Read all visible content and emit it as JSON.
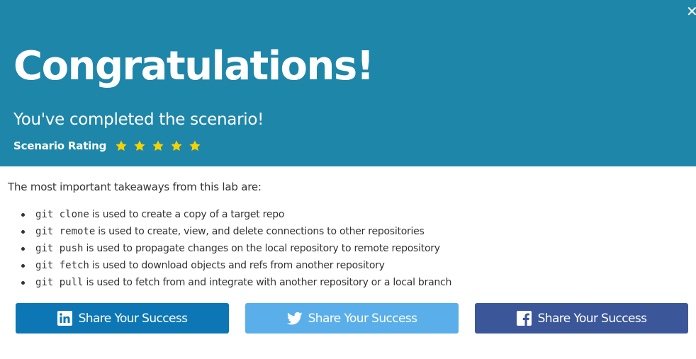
{
  "header": {
    "close_symbol": "✕",
    "title": "Congratulations!",
    "subtitle": "You've completed the scenario!",
    "rating_label": "Scenario Rating",
    "rating_stars": 5,
    "star_color": "#f7d200",
    "background_color": "#1e86a9"
  },
  "body": {
    "intro": "The most important takeaways from this lab are:",
    "takeaways": [
      {
        "command": "git clone",
        "text": "is used to create a copy of a target repo"
      },
      {
        "command": "git remote",
        "text": "is used to create, view, and delete connections to other repositories"
      },
      {
        "command": "git push",
        "text": "is used to propagate changes on the local repository to remote repository"
      },
      {
        "command": "git fetch",
        "text": "is used to download objects and refs from another repository"
      },
      {
        "command": "git pull",
        "text": "is used to fetch from and integrate with another repository or a local branch"
      }
    ]
  },
  "share": {
    "linkedin": {
      "label": "Share Your Success",
      "icon": "linkedin-icon",
      "color": "#0d77b5"
    },
    "twitter": {
      "label": "Share Your Success",
      "icon": "twitter-icon",
      "color": "#5aafea"
    },
    "facebook": {
      "label": "Share Your Success",
      "icon": "facebook-icon",
      "color": "#3b579a"
    }
  }
}
